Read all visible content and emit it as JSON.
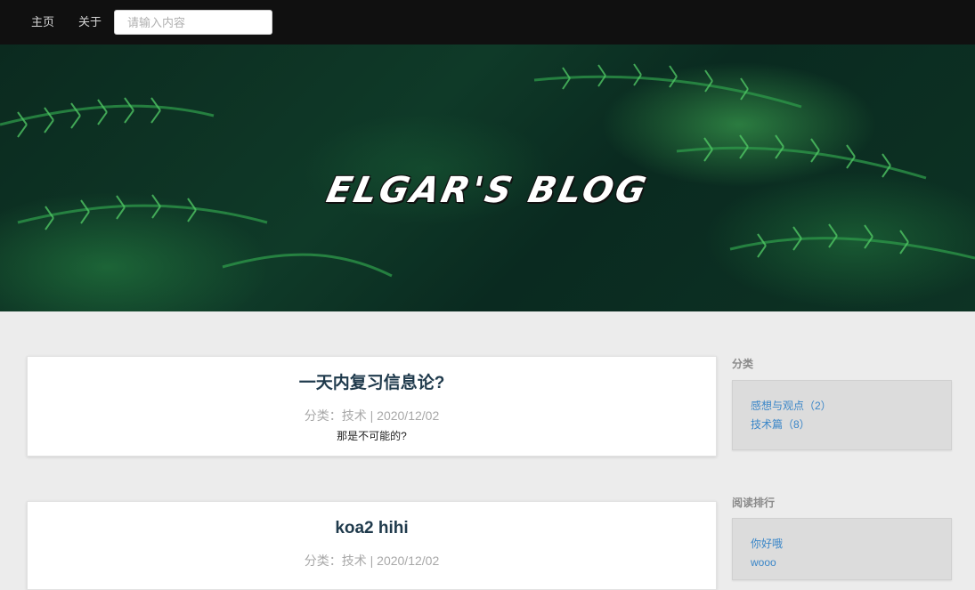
{
  "nav": {
    "home_label": "主页",
    "about_label": "关于",
    "search_placeholder": "请输入内容",
    "search_value": ""
  },
  "hero": {
    "title": "ELGAR'S BLOG"
  },
  "posts": [
    {
      "title": "一天内复习信息论?",
      "meta": "分类：技术 | 2020/12/02",
      "excerpt": "那是不可能的?"
    },
    {
      "title": "koa2 hihi",
      "meta": "分类：技术 | 2020/12/02",
      "excerpt": ""
    }
  ],
  "sidebar": {
    "categories_heading": "分类",
    "categories": [
      {
        "label": "感想与观点（2）"
      },
      {
        "label": "技术篇（8）"
      }
    ],
    "ranking_heading": "阅读排行",
    "ranking": [
      {
        "label": "你好哦"
      },
      {
        "label": "wooo"
      }
    ]
  },
  "colors": {
    "navbar": "#101010",
    "background": "#ececec",
    "link": "#3a86c8",
    "post_title": "#1f3a4c"
  }
}
